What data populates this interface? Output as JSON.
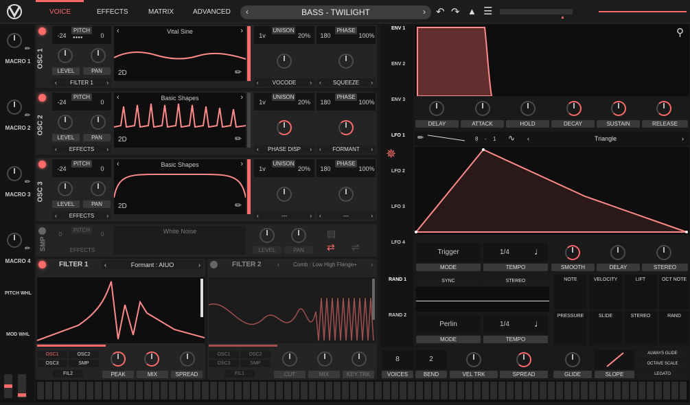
{
  "header": {
    "tabs": [
      "VOICE",
      "EFFECTS",
      "MATRIX",
      "ADVANCED"
    ],
    "preset_name": "BASS - TWILIGHT",
    "accent": "#ff6b6b"
  },
  "macros": [
    "MACRO 1",
    "MACRO 2",
    "MACRO 3",
    "MACRO 4"
  ],
  "side": {
    "pitch_whl": "PITCH WHL",
    "mod_whl": "MOD WHL"
  },
  "osc": [
    {
      "name": "OSC 1",
      "pitch_label": "PITCH",
      "transpose": "-24",
      "tune": "0",
      "wave": "Vital Sine",
      "dim": "2D",
      "level": "LEVEL",
      "pan": "PAN",
      "dest": "FILTER 1",
      "unison_label": "UNISON",
      "voices": "1v",
      "detune": "20%",
      "phase_label": "PHASE",
      "phase": "180",
      "rand": "100%",
      "mode1": "VOCODE",
      "mode2": "SQUEEZE"
    },
    {
      "name": "OSC 2",
      "pitch_label": "PITCH",
      "transpose": "-24",
      "tune": "0",
      "wave": "Basic Shapes",
      "dim": "2D",
      "level": "LEVEL",
      "pan": "PAN",
      "dest": "EFFECTS",
      "unison_label": "UNISON",
      "voices": "1v",
      "detune": "20%",
      "phase_label": "PHASE",
      "phase": "180",
      "rand": "100%",
      "mode1": "PHASE DISP",
      "mode2": "FORMANT"
    },
    {
      "name": "OSC 3",
      "pitch_label": "PITCH",
      "transpose": "-24",
      "tune": "0",
      "wave": "Basic Shapes",
      "dim": "2D",
      "level": "LEVEL",
      "pan": "PAN",
      "dest": "EFFECTS",
      "unison_label": "UNISON",
      "voices": "1v",
      "detune": "20%",
      "phase_label": "PHASE",
      "phase": "180",
      "rand": "100%",
      "mode1": "---",
      "mode2": "---"
    }
  ],
  "smp": {
    "name": "SMP",
    "pitch_label": "PITCH",
    "transpose": "0",
    "tune": "0",
    "sample": "White Noise",
    "dest": "EFFECTS",
    "level": "LEVEL",
    "pan": "PAN"
  },
  "filter1": {
    "name": "FILTER 1",
    "type": "Formant : AIUO",
    "osc1": "OSC1",
    "osc2": "OSC2",
    "osc3": "OSC3",
    "smp": "SMP",
    "fil": "FIL2",
    "k1": "PEAK",
    "k2": "MIX",
    "k3": "SPREAD"
  },
  "filter2": {
    "name": "FILTER 2",
    "type": "Comb : Low High Flange+",
    "osc1": "OSC1",
    "osc2": "OSC2",
    "osc3": "OSC3",
    "smp": "SMP",
    "fil": "FIL1",
    "k1": "CUT",
    "k2": "MIX",
    "k3": "KEY TRK"
  },
  "env": {
    "labels": [
      "ENV 1",
      "ENV 2",
      "ENV 3"
    ],
    "knobs": [
      "DELAY",
      "ATTACK",
      "HOLD",
      "DECAY",
      "SUSTAIN",
      "RELEASE"
    ]
  },
  "lfo": {
    "labels": [
      "LFO 1",
      "LFO 2",
      "LFO 3",
      "LFO 4"
    ],
    "rate_a": "8",
    "rate_sep": "-",
    "rate_b": "1",
    "shape": "Triangle",
    "trigger": "Trigger",
    "mode": "MODE",
    "tempo_val": "1/4",
    "tempo": "TEMPO",
    "knobs": [
      "SMOOTH",
      "DELAY",
      "STEREO"
    ]
  },
  "rand": {
    "labels": [
      "RAND 1",
      "RAND 2"
    ],
    "sync": "SYNC",
    "stereo": "STEREO",
    "style": "Perlin",
    "mode": "MODE",
    "tempo_val": "1/4",
    "tempo": "TEMPO"
  },
  "mod_sources": [
    "NOTE",
    "VELOCITY",
    "LIFT",
    "OCT NOTE",
    "PRESSURE",
    "SLIDE",
    "STEREO",
    "RAND"
  ],
  "voice": {
    "voices_val": "8",
    "voices": "VOICES",
    "bend_val": "2",
    "bend": "BEND",
    "vel_trk": "VEL TRK",
    "spread": "SPREAD",
    "glide": "GLIDE",
    "slope": "SLOPE",
    "always_glide": "ALWAYS GLIDE",
    "octave_scale": "OCTAVE SCALE",
    "legato": "LEGATO"
  },
  "chart_data": [
    {
      "type": "line",
      "title": "",
      "x": [
        0,
        0.5,
        1,
        1.5,
        2,
        2.5,
        3,
        3.5,
        4
      ],
      "series": [
        {
          "values": [
            0.5,
            0.8,
            0.5,
            0.2,
            0.5,
            0.8,
            0.5,
            0.2,
            0.5
          ]
        }
      ]
    },
    {
      "type": "line",
      "title": "",
      "x": [
        0,
        0.25,
        0.5,
        0.75,
        1
      ],
      "series": [
        {
          "values": [
            0,
            1,
            0.67,
            0.33,
            0
          ]
        }
      ]
    }
  ]
}
